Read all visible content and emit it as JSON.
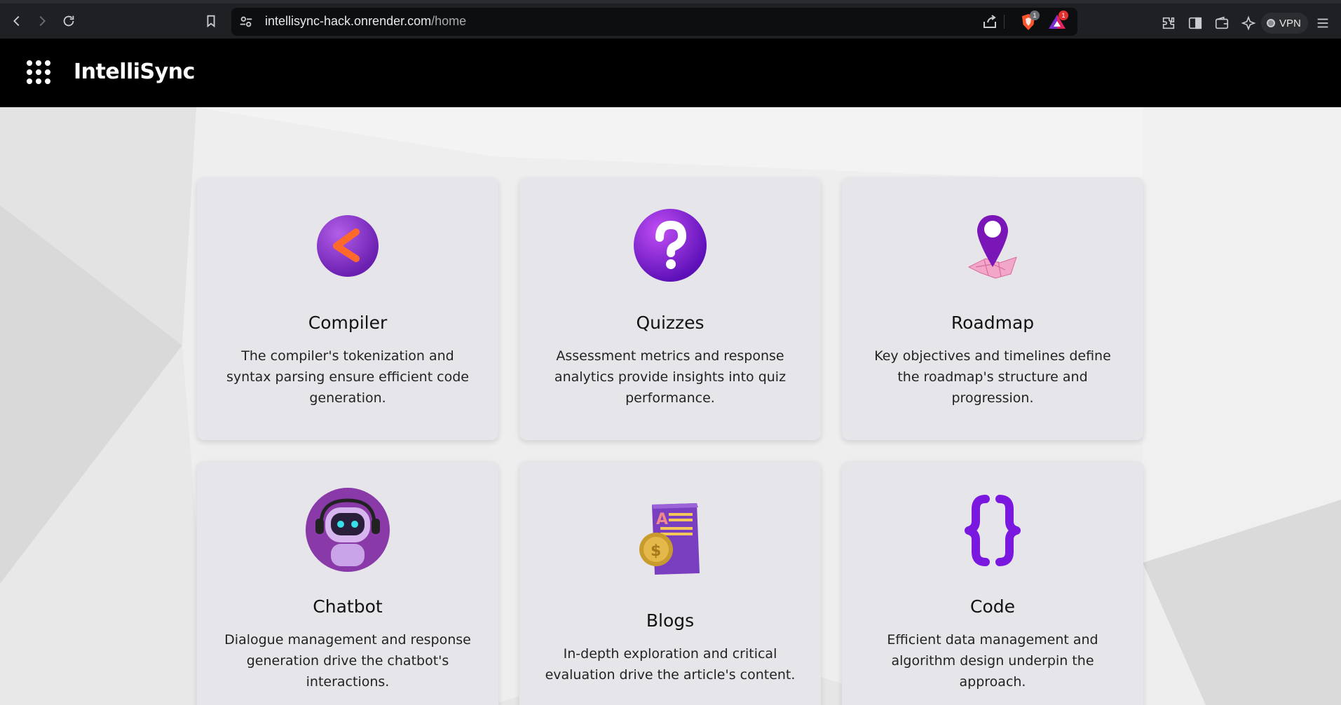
{
  "browser": {
    "url_host": "intellisync-hack.onrender.com",
    "url_path": "/home",
    "shield_badge": "1",
    "rewards_badge": "1",
    "vpn_label": "VPN"
  },
  "header": {
    "brand": "IntelliSync"
  },
  "cards": [
    {
      "title": "Compiler",
      "description": "The compiler's tokenization and syntax parsing ensure efficient code generation.",
      "icon": "compiler-icon"
    },
    {
      "title": "Quizzes",
      "description": "Assessment metrics and response analytics provide insights into quiz performance.",
      "icon": "question-mark-icon"
    },
    {
      "title": "Roadmap",
      "description": "Key objectives and timelines define the roadmap's structure and progression.",
      "icon": "map-pin-icon"
    },
    {
      "title": "Chatbot",
      "description": "Dialogue management and response generation drive the chatbot's interactions.",
      "icon": "robot-icon"
    },
    {
      "title": "Blogs",
      "description": "In-depth exploration and critical evaluation drive the article's content.",
      "icon": "article-coin-icon"
    },
    {
      "title": "Code",
      "description": "Efficient data management and algorithm design underpin the approach.",
      "icon": "curly-braces-icon"
    }
  ],
  "colors": {
    "accent_purple": "#7b2bd0",
    "header_bg": "#000000",
    "card_bg": "#e6e6ea"
  }
}
